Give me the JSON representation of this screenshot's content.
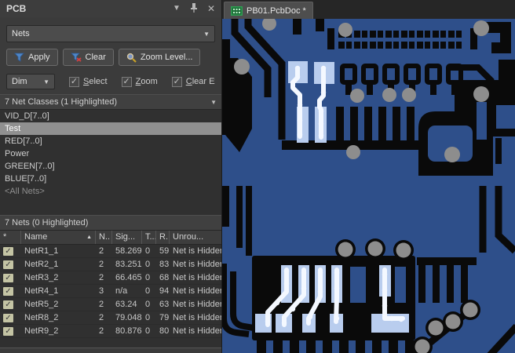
{
  "panel": {
    "title": "PCB",
    "header_icons": [
      "dropdown-icon",
      "pin-icon",
      "close-icon"
    ],
    "selector_value": "Nets",
    "buttons": {
      "apply": "Apply",
      "clear": "Clear",
      "zoom_level": "Zoom Level..."
    },
    "dim_value": "Dim",
    "option_checkboxes": [
      {
        "label": "Select",
        "checked": true
      },
      {
        "label": "Zoom",
        "checked": true
      },
      {
        "label": "Clear Existing",
        "checked": true
      }
    ],
    "net_classes": {
      "header": "7 Net Classes (1 Highlighted)",
      "items": [
        {
          "label": "VID_D[7..0]"
        },
        {
          "label": "Test",
          "highlighted": true
        },
        {
          "label": "RED[7..0]"
        },
        {
          "label": "Power"
        },
        {
          "label": "GREEN[7..0]"
        },
        {
          "label": "BLUE[7..0]"
        },
        {
          "label": "<All Nets>",
          "dim": true
        }
      ]
    },
    "nets": {
      "header": "7 Nets (0 Highlighted)",
      "columns": [
        "*",
        "Name",
        "N..",
        "Sig...",
        "T...",
        "R...",
        "Unrou..."
      ],
      "rows": [
        {
          "checked": true,
          "name": "NetR1_1",
          "nodes": "2",
          "signal": "58.269",
          "t": "0",
          "routed": "59",
          "unrouted": "Net is Hidden"
        },
        {
          "checked": true,
          "name": "NetR2_1",
          "nodes": "2",
          "signal": "83.251",
          "t": "0",
          "routed": "83.",
          "unrouted": "Net is Hidden"
        },
        {
          "checked": true,
          "name": "NetR3_2",
          "nodes": "2",
          "signal": "66.465",
          "t": "0",
          "routed": "68.",
          "unrouted": "Net is Hidden"
        },
        {
          "checked": true,
          "name": "NetR4_1",
          "nodes": "3",
          "signal": "n/a",
          "t": "0",
          "routed": "94.",
          "unrouted": "Net is Hidden"
        },
        {
          "checked": true,
          "name": "NetR5_2",
          "nodes": "2",
          "signal": "63.24",
          "t": "0",
          "routed": "63.",
          "unrouted": "Net is Hidden"
        },
        {
          "checked": true,
          "name": "NetR8_2",
          "nodes": "2",
          "signal": "79.048",
          "t": "0",
          "routed": "79.",
          "unrouted": "Net is Hidden"
        },
        {
          "checked": true,
          "name": "NetR9_2",
          "nodes": "2",
          "signal": "80.876",
          "t": "0",
          "routed": "80.",
          "unrouted": "Net is Hidden"
        }
      ]
    }
  },
  "document_tab": {
    "title": "PB01.PcbDoc *"
  },
  "pcb": {
    "colors": {
      "board": "#2e4f8a",
      "copper_dark": "#0a0a0a",
      "via": "#8d8d8d",
      "highlight_pad": "#b9cdee",
      "highlight_trace": "#f4f8ff"
    }
  }
}
